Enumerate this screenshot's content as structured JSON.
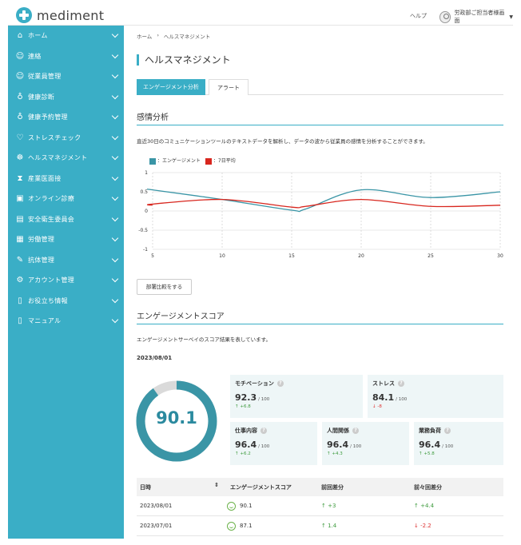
{
  "header": {
    "logo": "mediment",
    "help": "ヘルプ",
    "user": "労政部ご担当者様画面"
  },
  "sidebar": {
    "items": [
      {
        "label": "ホーム",
        "icon": "home-icon"
      },
      {
        "label": "連絡",
        "icon": "people-icon"
      },
      {
        "label": "従業員管理",
        "icon": "people-icon"
      },
      {
        "label": "健康診断",
        "icon": "stethoscope-icon"
      },
      {
        "label": "健康予約管理",
        "icon": "stethoscope-icon"
      },
      {
        "label": "ストレスチェック",
        "icon": "heart-icon"
      },
      {
        "label": "ヘルスマネジメント",
        "icon": "group-icon"
      },
      {
        "label": "産業医面接",
        "icon": "hourglass-icon"
      },
      {
        "label": "オンライン診療",
        "icon": "monitor-icon"
      },
      {
        "label": "安全衛生委員会",
        "icon": "document-icon"
      },
      {
        "label": "労働管理",
        "icon": "calendar-icon"
      },
      {
        "label": "抗体管理",
        "icon": "syringe-icon"
      },
      {
        "label": "アカウント管理",
        "icon": "gear-icon"
      },
      {
        "label": "お役立ち情報",
        "icon": "book-icon"
      },
      {
        "label": "マニュアル",
        "icon": "book-icon"
      }
    ]
  },
  "breadcrumb": {
    "home": "ホーム",
    "sep": "›",
    "current": "ヘルスマネジメント"
  },
  "page": {
    "title": "ヘルスマネジメント"
  },
  "tabs": {
    "active": "エンゲージメント分析",
    "inactive": "アラート"
  },
  "sentiment": {
    "title": "感情分析",
    "description": "直近30日のコミュニケーションツールのテキストデータを解析し、データの波から従業員の感情を分析することができます。",
    "dept_button": "部署比較をする"
  },
  "chart_data": {
    "type": "line",
    "x": [
      1,
      5,
      10,
      15,
      16,
      20,
      25,
      30
    ],
    "series": [
      {
        "name": "：エンゲージメント",
        "color": "#3a95a6",
        "values": [
          0.55,
          0.55,
          0.3,
          0.02,
          0.05,
          0.55,
          0.35,
          0.5
        ]
      },
      {
        "name": "：7日平均",
        "color": "#d8261e",
        "values": [
          0.15,
          0.18,
          0.3,
          0.1,
          0.12,
          0.3,
          0.12,
          0.15
        ]
      }
    ],
    "xticks": [
      5,
      10,
      15,
      20,
      25,
      30
    ],
    "yticks": [
      1,
      0.5,
      0,
      -0.5,
      -1
    ],
    "ylim": [
      -1,
      1
    ],
    "xlim": [
      5,
      30
    ],
    "grid": true
  },
  "score": {
    "title": "エンゲージメントスコア",
    "description": "エンゲージメントサーベイのスコア結果を表しています。",
    "date": "2023/08/01",
    "total": "90.1",
    "total_fraction": 0.9,
    "cards": [
      {
        "title": "モチベーション",
        "score": "92.3",
        "denom": "/ 100",
        "delta": "↑ +6.8",
        "dir": "up"
      },
      {
        "title": "ストレス",
        "score": "84.1",
        "denom": "/ 100",
        "delta": "↓ -8",
        "dir": "down"
      },
      {
        "title": "仕事内容",
        "score": "96.4",
        "denom": "/ 100",
        "delta": "↑ +6.2",
        "dir": "up"
      },
      {
        "title": "人間関係",
        "score": "96.4",
        "denom": "/ 100",
        "delta": "↑ +4.3",
        "dir": "up"
      },
      {
        "title": "業務負荷",
        "score": "96.4",
        "denom": "/ 100",
        "delta": "↑ +5.8",
        "dir": "up"
      }
    ]
  },
  "table": {
    "headers": [
      "日時",
      "エンゲージメントスコア",
      "前回差分",
      "前々回差分"
    ],
    "sort_icon": "⇕",
    "rows": [
      {
        "date": "2023/08/01",
        "score": "90.1",
        "prev": "↑ +3",
        "prev_dir": "up",
        "prev2": "↑ +4.4",
        "prev2_dir": "up"
      },
      {
        "date": "2023/07/01",
        "score": "87.1",
        "prev": "↑ 1.4",
        "prev_dir": "up",
        "prev2": "↓ -2.2",
        "prev2_dir": "down"
      }
    ]
  }
}
